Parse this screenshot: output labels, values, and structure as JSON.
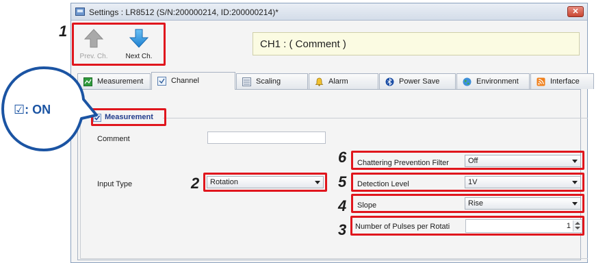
{
  "window": {
    "title": "Settings : LR8512 (S/N:200000214, ID:200000214)*",
    "close_glyph": "✕"
  },
  "nav": {
    "prev_label": "Prev. Ch.",
    "next_label": "Next Ch."
  },
  "channel": {
    "title": "CH1 : ( Comment )"
  },
  "tabs": [
    {
      "label": "Measurement",
      "icon": "measurement-icon",
      "active": false
    },
    {
      "label": "Channel",
      "icon": "channel-icon",
      "active": true
    },
    {
      "label": "Scaling",
      "icon": "scaling-icon",
      "active": false
    },
    {
      "label": "Alarm",
      "icon": "bell-icon",
      "active": false
    },
    {
      "label": "Power Save",
      "icon": "bluetooth-icon",
      "active": false
    },
    {
      "label": "Environment",
      "icon": "globe-icon",
      "active": false
    },
    {
      "label": "Interface",
      "icon": "rss-icon",
      "active": false
    }
  ],
  "group": {
    "label": "Measurement",
    "checked": true
  },
  "fields": {
    "comment_label": "Comment",
    "comment_value": "",
    "input_type_label": "Input Type",
    "input_type_value": "Rotation",
    "chattering_label": "Chattering Prevention Filter",
    "chattering_value": "Off",
    "detection_label": "Detection Level",
    "detection_value": "1V",
    "slope_label": "Slope",
    "slope_value": "Rise",
    "pulses_label": "Number of Pulses per Rotati",
    "pulses_value": "1"
  },
  "annotations": {
    "n1": "1",
    "n2": "2",
    "n3": "3",
    "n4": "4",
    "n5": "5",
    "n6": "6",
    "callout_check": "☑",
    "callout_text": ": ON"
  },
  "colors": {
    "highlight": "#e0161d",
    "callout": "#1b54a3",
    "group_label": "#213c8c"
  }
}
